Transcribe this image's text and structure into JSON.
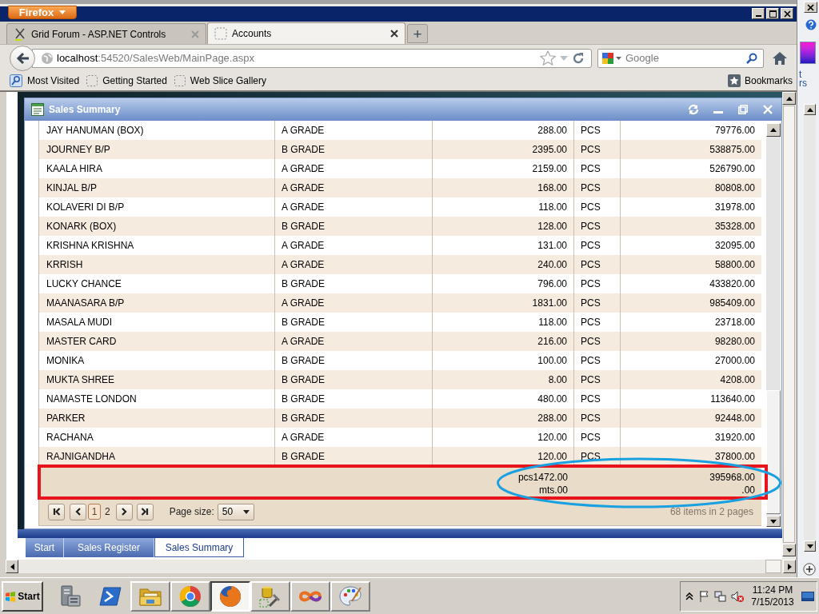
{
  "browser": {
    "menu_button": "Firefox",
    "tabs": [
      {
        "label": "Grid Forum - ASP.NET Controls",
        "kind": "site",
        "selected": false
      },
      {
        "label": "Accounts",
        "kind": "page",
        "selected": true
      }
    ],
    "new_tab": "+",
    "url": {
      "host": "localhost",
      "path": ":54520/SalesWeb/MainPage.aspx"
    },
    "search": {
      "placeholder": "Google"
    },
    "bookmarks": [
      {
        "label": "Most Visited",
        "kind": "folder"
      },
      {
        "label": "Getting Started",
        "kind": "page"
      },
      {
        "label": "Web Slice Gallery",
        "kind": "page"
      }
    ],
    "bookmarks_menu": "Bookmarks"
  },
  "app_window": {
    "title": "Sales Summary"
  },
  "table": {
    "rows": [
      [
        "JAY HANUMAN (BOX)",
        "A GRADE",
        "288.00",
        "PCS",
        "79776.00"
      ],
      [
        "JOURNEY B/P",
        "B GRADE",
        "2395.00",
        "PCS",
        "538875.00"
      ],
      [
        "KAALA HIRA",
        "A GRADE",
        "2159.00",
        "PCS",
        "526790.00"
      ],
      [
        "KINJAL B/P",
        "A GRADE",
        "168.00",
        "PCS",
        "80808.00"
      ],
      [
        "KOLAVERI DI B/P",
        "A GRADE",
        "118.00",
        "PCS",
        "31978.00"
      ],
      [
        "KONARK (BOX)",
        "B GRADE",
        "128.00",
        "PCS",
        "35328.00"
      ],
      [
        "KRISHNA KRISHNA",
        "A GRADE",
        "131.00",
        "PCS",
        "32095.00"
      ],
      [
        "KRRISH",
        "A GRADE",
        "240.00",
        "PCS",
        "58800.00"
      ],
      [
        "LUCKY CHANCE",
        "B GRADE",
        "796.00",
        "PCS",
        "433820.00"
      ],
      [
        "MAANASARA B/P",
        "A GRADE",
        "1831.00",
        "PCS",
        "985409.00"
      ],
      [
        "MASALA MUDI",
        "B GRADE",
        "118.00",
        "PCS",
        "23718.00"
      ],
      [
        "MASTER CARD",
        "A GRADE",
        "216.00",
        "PCS",
        "98280.00"
      ],
      [
        "MONIKA",
        "B GRADE",
        "100.00",
        "PCS",
        "27000.00"
      ],
      [
        "MUKTA SHREE",
        "B GRADE",
        "8.00",
        "PCS",
        "4208.00"
      ],
      [
        "NAMASTE LONDON",
        "B GRADE",
        "480.00",
        "PCS",
        "113640.00"
      ],
      [
        "PARKER",
        "B GRADE",
        "288.00",
        "PCS",
        "92448.00"
      ],
      [
        "RACHANA",
        "A GRADE",
        "120.00",
        "PCS",
        "31920.00"
      ],
      [
        "RAJNIGANDHA",
        "B GRADE",
        "120.00",
        "PCS",
        "37800.00"
      ]
    ]
  },
  "table_footer": {
    "rows": [
      {
        "column_3": "pcs1472.00",
        "column_5": "395968.00"
      },
      {
        "column_3": "mts.00",
        "column_5": ".00"
      }
    ]
  },
  "pager": {
    "pages": [
      {
        "label": "1",
        "selected": true
      },
      {
        "label": "2",
        "selected": false
      }
    ],
    "page_size_label": "Page size:",
    "page_size": "50",
    "summary": "68 items in 2 pages"
  },
  "app_tabs": [
    {
      "label": "Start",
      "selected": false
    },
    {
      "label": "Sales Register",
      "selected": false
    },
    {
      "label": "Sales Summary",
      "selected": true
    }
  ],
  "annotations": [
    {
      "kind": "rectangle"
    },
    {
      "kind": "ellipse"
    }
  ],
  "background_window": {
    "texts": [
      "t",
      "rs"
    ]
  },
  "taskbar": {
    "start": "Start",
    "apps": [
      {
        "kind": "server",
        "open": false,
        "selected": false
      },
      {
        "kind": "terminal",
        "open": false,
        "selected": false
      },
      {
        "kind": "folder",
        "open": true,
        "selected": false
      },
      {
        "kind": "wheel",
        "open": true,
        "selected": false
      },
      {
        "kind": "globe",
        "open": true,
        "selected": true
      },
      {
        "kind": "tools",
        "open": true,
        "selected": false
      },
      {
        "kind": "infinity",
        "open": true,
        "selected": false
      },
      {
        "kind": "palette",
        "open": true,
        "selected": false
      }
    ],
    "time": "11:24 PM",
    "date": "7/15/2013"
  }
}
